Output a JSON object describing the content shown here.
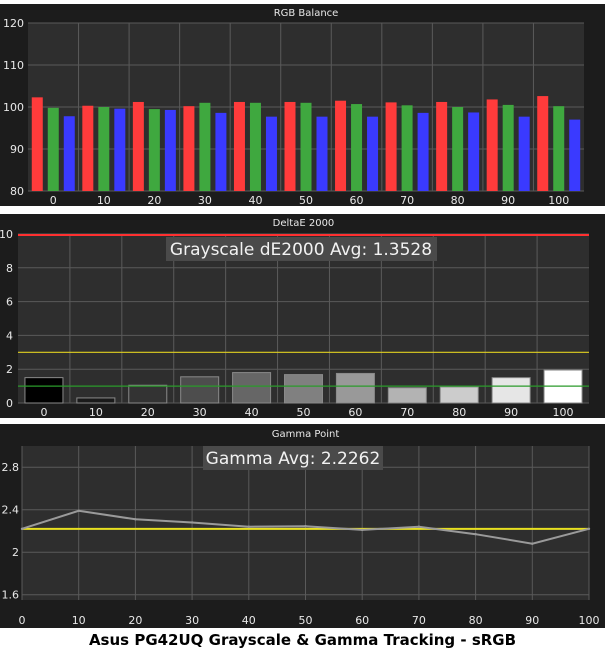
{
  "caption": "Asus PG42UQ Grayscale & Gamma Tracking - sRGB",
  "colors": {
    "frame_bg": "#1c1c1c",
    "plot_bg": "#2e2e2e",
    "grid": "#5a5a5a",
    "text": "#e8e8e8",
    "red": "#ff3b3b",
    "green": "#3fa83f",
    "blue": "#3a3aff",
    "threshold_high": "#e0d020",
    "threshold_low": "#2a9a2a",
    "limit_line": "#ff3030",
    "gamma_line": "#9a9a9a",
    "gamma_target": "#e8e020"
  },
  "chart_data": [
    {
      "type": "bar",
      "title": "RGB Balance",
      "categories": [
        "0",
        "10",
        "20",
        "30",
        "40",
        "50",
        "60",
        "70",
        "80",
        "90",
        "100"
      ],
      "ylim": [
        80,
        120
      ],
      "yticks": [
        80,
        90,
        100,
        110,
        120
      ],
      "series": [
        {
          "values": [
            102.3,
            100.3,
            101.2,
            100.2,
            101.2,
            101.2,
            101.5,
            101.1,
            101.2,
            101.8,
            102.6
          ]
        },
        {
          "values": [
            99.8,
            100.0,
            99.5,
            101.0,
            101.0,
            101.0,
            100.7,
            100.4,
            100.0,
            100.5,
            100.2
          ]
        },
        {
          "values": [
            97.8,
            99.6,
            99.3,
            98.6,
            97.7,
            97.7,
            97.7,
            98.6,
            98.7,
            97.7,
            97.0
          ]
        }
      ]
    },
    {
      "type": "bar",
      "title": "DeltaE 2000",
      "annotation": "Grayscale dE2000 Avg: 1.3528",
      "categories": [
        "0",
        "10",
        "20",
        "30",
        "40",
        "50",
        "60",
        "70",
        "80",
        "90",
        "100"
      ],
      "values": [
        1.5,
        0.3,
        1.05,
        1.55,
        1.8,
        1.68,
        1.75,
        0.9,
        0.95,
        1.5,
        1.95
      ],
      "ylim": [
        0,
        10
      ],
      "yticks": [
        0,
        2,
        4,
        6,
        8,
        10
      ],
      "thresholds": [
        3,
        1
      ],
      "limit": 10
    },
    {
      "type": "line",
      "title": "Gamma Point",
      "annotation": "Gamma Avg: 2.2262",
      "x": [
        0,
        10,
        20,
        30,
        40,
        50,
        60,
        70,
        80,
        90,
        100
      ],
      "y": [
        2.22,
        2.39,
        2.31,
        2.28,
        2.24,
        2.245,
        2.21,
        2.24,
        2.17,
        2.08,
        2.22
      ],
      "target": 2.22,
      "xlim": [
        0,
        100
      ],
      "ylim": [
        1.55,
        3.0
      ],
      "yticks": [
        1.6,
        2.0,
        2.4,
        2.8
      ],
      "ytick_labels": [
        "1.6",
        "2",
        "2.4",
        "2.8"
      ],
      "xticks": [
        0,
        10,
        20,
        30,
        40,
        50,
        60,
        70,
        80,
        90,
        100
      ]
    }
  ]
}
